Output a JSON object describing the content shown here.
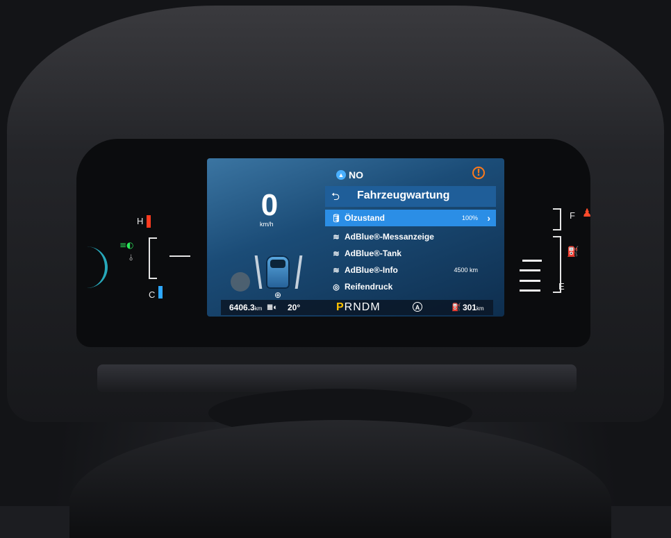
{
  "compass": {
    "direction": "NO"
  },
  "gauges": {
    "temp_high": "H",
    "temp_low": "C",
    "fuel_full": "F",
    "fuel_empty": "E"
  },
  "speed": {
    "value": "0",
    "unit": "km/h"
  },
  "menu": {
    "title": "Fahrzeugwartung",
    "items": [
      {
        "label": "Ölzustand",
        "value": "100%",
        "icon": "oil-can-icon",
        "selected": true
      },
      {
        "label": "AdBlue®-Messanzeige",
        "value": "",
        "icon": "adblue-icon",
        "selected": false
      },
      {
        "label": "AdBlue®-Tank",
        "value": "",
        "icon": "adblue-icon",
        "selected": false
      },
      {
        "label": "AdBlue®-Info",
        "value": "4500 km",
        "icon": "adblue-icon",
        "selected": false
      },
      {
        "label": "Reifendruck",
        "value": "",
        "icon": "tire-pressure-icon",
        "selected": false
      }
    ]
  },
  "status": {
    "odometer": "6406.3",
    "odometer_unit": "km",
    "temperature": "20°",
    "gear_selected": "P",
    "gears_rest": "RNDM",
    "auto": "A",
    "range": "301",
    "range_unit": "km"
  },
  "colors": {
    "accent": "#2b8ee6",
    "warning": "#ff7a1a",
    "gear_highlight": "#ffc300",
    "temp_hot": "#ff3b1f",
    "temp_cold": "#2ea8ff"
  }
}
